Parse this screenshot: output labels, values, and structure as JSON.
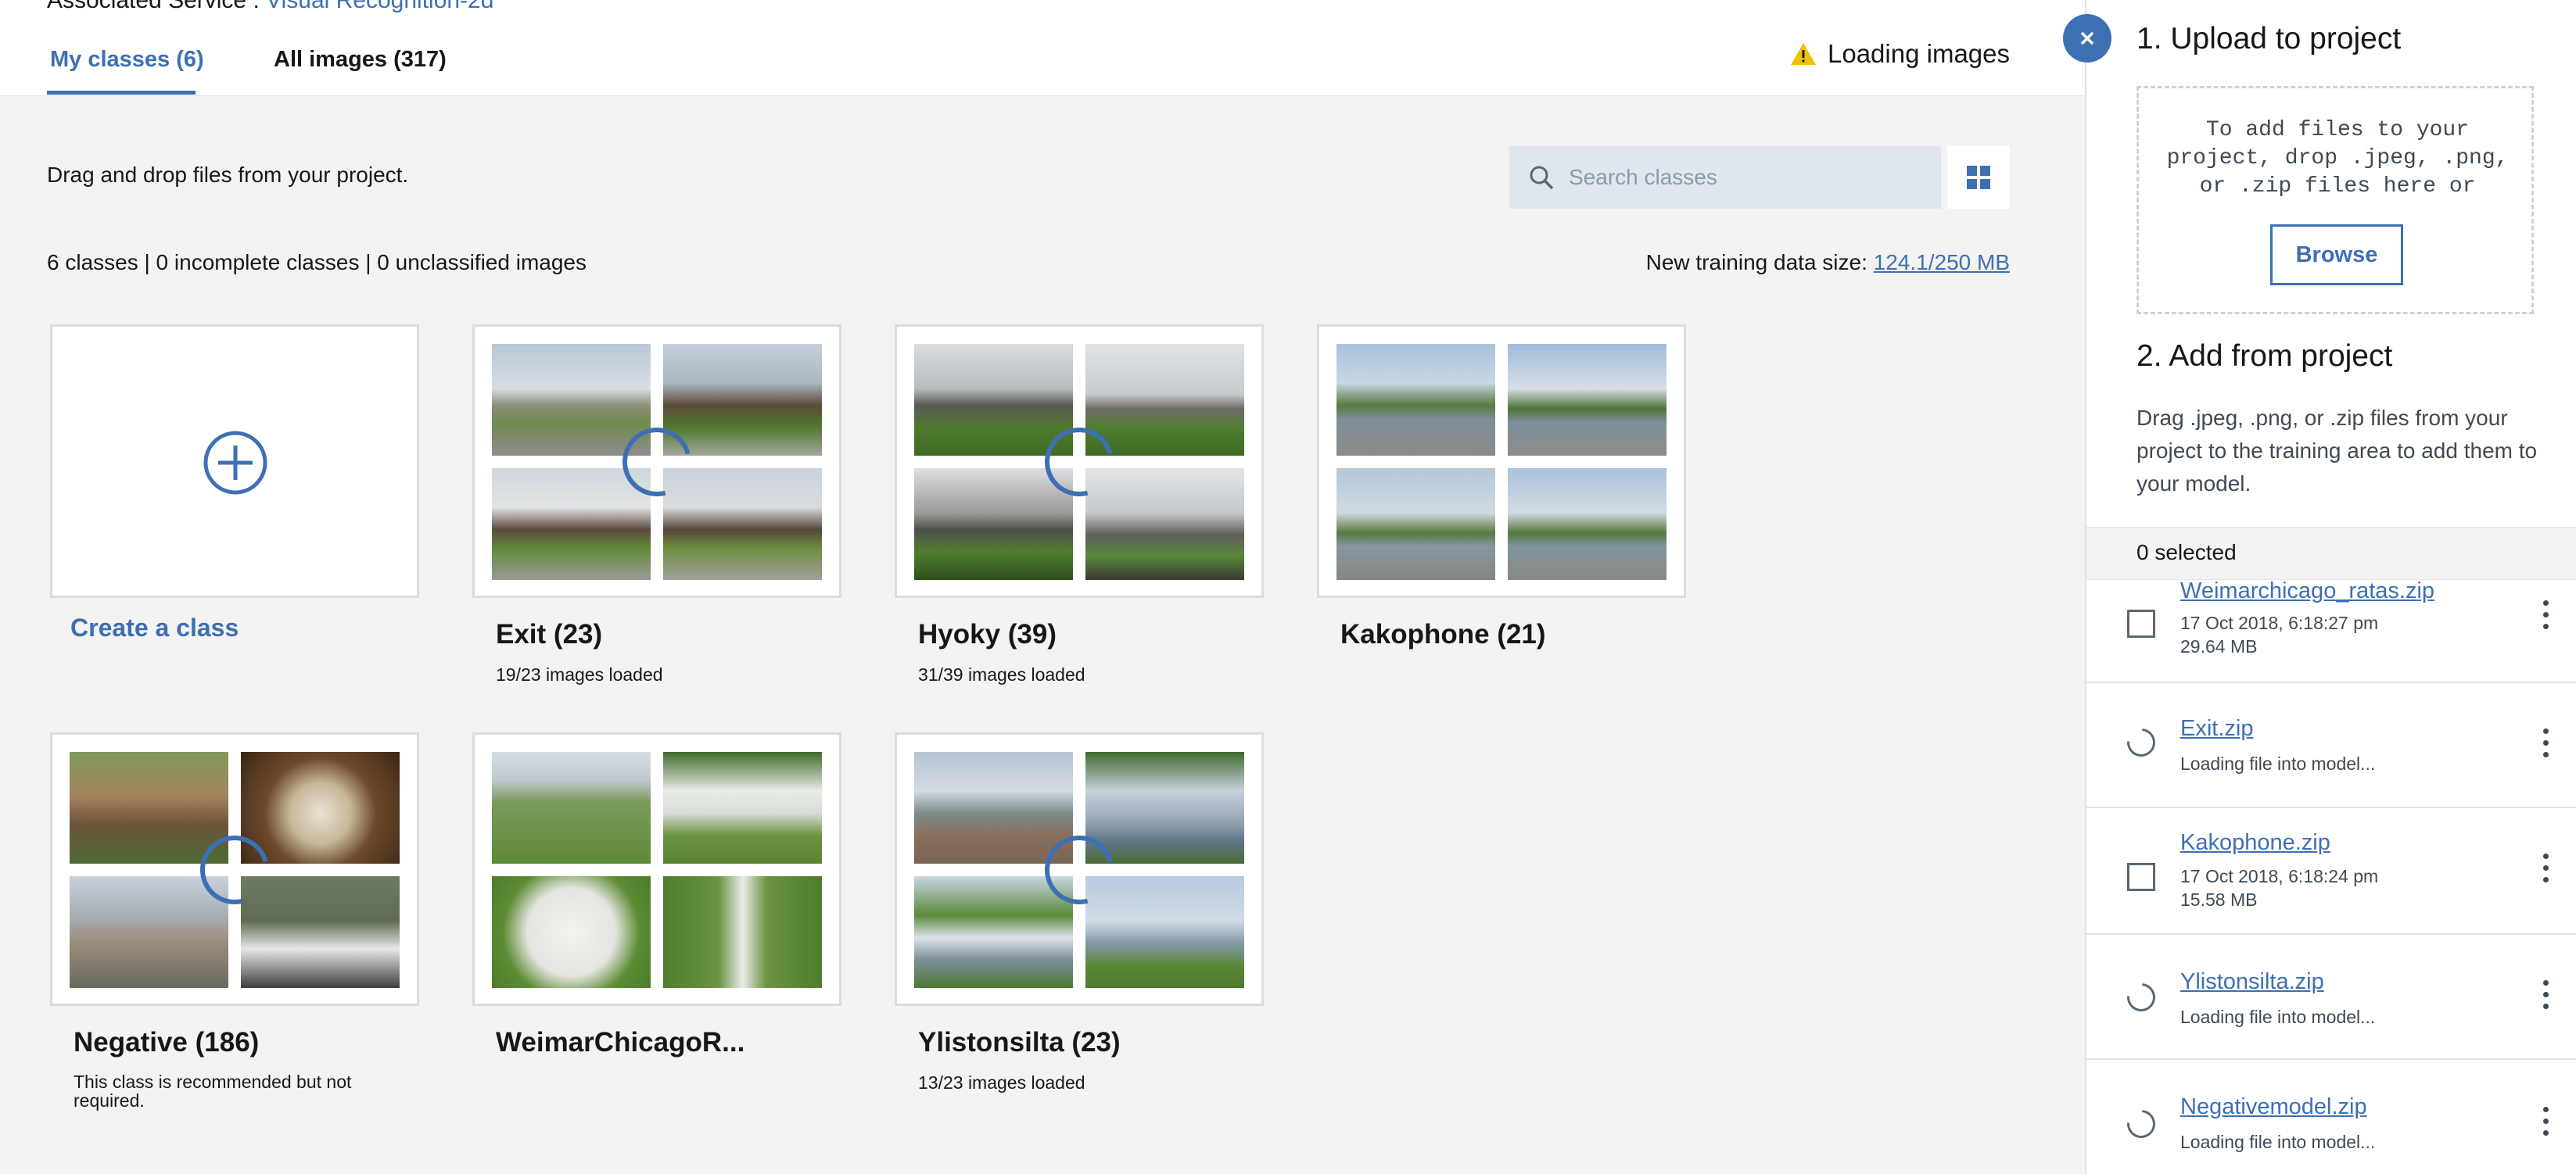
{
  "header": {
    "associated_label": "Associated Service : ",
    "associated_value": "Visual Recognition-2d",
    "tabs": [
      {
        "label": "My classes (6)",
        "active": true
      },
      {
        "label": "All images (317)",
        "active": false
      }
    ],
    "status_text": "Loading images"
  },
  "toolbar": {
    "instructions": "Drag and drop files from your project.",
    "search_placeholder": "Search classes"
  },
  "summary": {
    "text": "6 classes | 0 incomplete classes | 0 unclassified images",
    "size_label": "New training data size: ",
    "size_value": "124.1/250 MB"
  },
  "create_class_label": "Create a class",
  "classes": [
    {
      "title": "Exit (23)",
      "subtitle": "19/23 images loaded"
    },
    {
      "title": "Hyoky (39)",
      "subtitle": "31/39 images loaded"
    },
    {
      "title": "Kakophone (21)",
      "subtitle": ""
    },
    {
      "title": "Negative (186)",
      "subtitle": "This class is recommended but not required."
    },
    {
      "title": "WeimarChicagoR...",
      "subtitle": ""
    },
    {
      "title": "Ylistonsilta (23)",
      "subtitle": "13/23 images loaded"
    }
  ],
  "panel": {
    "upload_heading": "1. Upload to project",
    "drop_text": "To add files to your project, drop .jpeg, .png, or .zip files here or",
    "browse_label": "Browse",
    "add_heading": "2. Add from project",
    "add_text": "Drag .jpeg, .png, or .zip files from your project to the training area to add them to your model.",
    "selected_text": "0 selected",
    "files": [
      {
        "name": "Weimarchicago_ratas.zip",
        "line1": "17 Oct 2018, 6:18:27 pm",
        "line2": "29.64 MB",
        "state": "checkbox"
      },
      {
        "name": "Exit.zip",
        "line1": "Loading file into model...",
        "line2": "",
        "state": "loading"
      },
      {
        "name": "Kakophone.zip",
        "line1": "17 Oct 2018, 6:18:24 pm",
        "line2": "15.58 MB",
        "state": "checkbox"
      },
      {
        "name": "Ylistonsilta.zip",
        "line1": "Loading file into model...",
        "line2": "",
        "state": "loading"
      },
      {
        "name": "Negativemodel.zip",
        "line1": "Loading file into model...",
        "line2": "",
        "state": "loading"
      }
    ]
  }
}
